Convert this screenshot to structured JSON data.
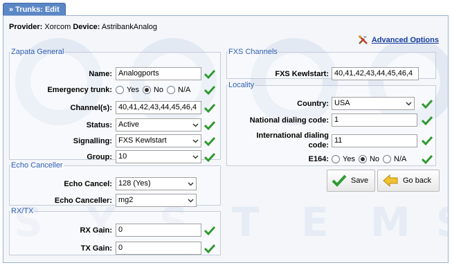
{
  "tab": {
    "title": "» Trunks: Edit"
  },
  "provider_line": {
    "provider_label": "Provider:",
    "provider_value": "Xorcom",
    "device_label": "Device:",
    "device_value": "AstribankAnalog"
  },
  "advanced_options": {
    "label": "Advanced Options",
    "icon": "tools-icon"
  },
  "zapata": {
    "legend": "Zapata General",
    "name_label": "Name:",
    "name_value": "Analogports",
    "emergency_label": "Emergency trunk:",
    "emergency_options": [
      "Yes",
      "No",
      "N/A"
    ],
    "emergency_selected": "No",
    "channels_label": "Channel(s):",
    "channels_value": "40,41,42,43,44,45,46,4",
    "status_label": "Status:",
    "status_value": "Active",
    "signalling_label": "Signalling:",
    "signalling_value": "FXS Kewlstart",
    "group_label": "Group:",
    "group_value": "10"
  },
  "echo": {
    "legend": "Echo Canceller",
    "cancel_label": "Echo Cancel:",
    "cancel_value": "128 (Yes)",
    "canceller_label": "Echo Canceller:",
    "canceller_value": "mg2"
  },
  "rxtx": {
    "legend": "RX/TX",
    "rx_label": "RX Gain:",
    "rx_value": "0",
    "tx_label": "TX Gain:",
    "tx_value": "0"
  },
  "fxs": {
    "legend": "FXS Channels",
    "kewlstart_label": "FXS Kewlstart:",
    "kewlstart_value": "40,41,42,43,44,45,46,4"
  },
  "locality": {
    "legend": "Locality",
    "country_label": "Country:",
    "country_value": "USA",
    "national_label": "National dialing code:",
    "national_value": "1",
    "international_label_1": "International dialing",
    "international_label_2": "code:",
    "international_value": "11",
    "e164_label": "E164:",
    "e164_options": [
      "Yes",
      "No",
      "N/A"
    ],
    "e164_selected": "No"
  },
  "buttons": {
    "save": "Save",
    "back": "Go back"
  },
  "colors": {
    "accent": "#5b87c6",
    "legend": "#3060b0",
    "check_green": "#2f9a2f",
    "link": "#1a3fa0"
  }
}
